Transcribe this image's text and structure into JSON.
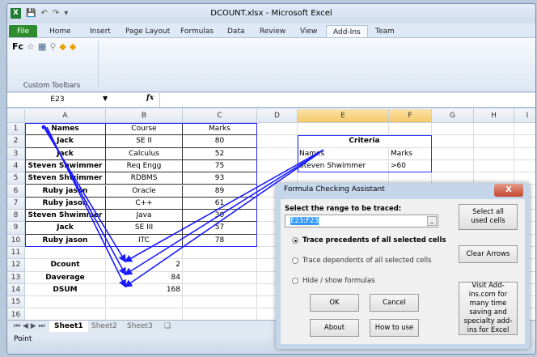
{
  "window": {
    "title": "DCOUNT.xlsx - Microsoft Excel"
  },
  "ribbon": {
    "tabs": [
      "File",
      "Home",
      "Insert",
      "Page Layout",
      "Formulas",
      "Data",
      "Review",
      "View",
      "Add-Ins",
      "Team"
    ],
    "active_tab": "Add-Ins",
    "group_label": "Custom Toolbars",
    "fc_label": "Fc"
  },
  "formula_bar": {
    "name_box": "E23",
    "fx": "fx",
    "value": ""
  },
  "columns": [
    "A",
    "B",
    "C",
    "D",
    "E",
    "F",
    "G",
    "H",
    "I"
  ],
  "selected_columns": [
    "E",
    "F"
  ],
  "rows": [
    "1",
    "2",
    "3",
    "4",
    "5",
    "6",
    "7",
    "8",
    "9",
    "10",
    "11",
    "12",
    "13",
    "14",
    "15",
    "16"
  ],
  "cells": {
    "A1": "Names",
    "B1": "Course",
    "C1": "Marks",
    "A2": "Jack",
    "B2": "SE II",
    "C2": "80",
    "A3": "Jack",
    "B3": "Calculus",
    "C3": "52",
    "A4": "Steven Shwimmer",
    "B4": "Req Engg",
    "C4": "75",
    "A5": "Steven Shwimmer",
    "B5": "RDBMS",
    "C5": "93",
    "A6": "Ruby jason",
    "B6": "Oracle",
    "C6": "89",
    "A7": "Ruby jason",
    "B7": "C++",
    "C7": "61",
    "A8": "Steven Shwimmer",
    "B8": "Java",
    "C8": "30",
    "A9": "Jack",
    "B9": "SE III",
    "C9": "57",
    "A10": "Ruby jason",
    "B10": "ITC",
    "C10": "78",
    "A12": "Dcount",
    "B12": "2",
    "A13": "Daverage",
    "B13": "84",
    "A14": "DSUM",
    "B14": "168",
    "E2": "Criteria",
    "E3": "Names",
    "F3": "Marks",
    "E4": "Steven Shwimmer",
    "F4": ">60"
  },
  "sheets": [
    "Sheet1",
    "Sheet2",
    "Sheet3"
  ],
  "active_sheet": "Sheet1",
  "status": "Point",
  "dialog": {
    "title": "Formula Checking Assistant",
    "close": "X",
    "range_label": "Select the range to be traced:",
    "range_value": "E23:F23",
    "options": [
      {
        "label": "Trace precedents of all selected cells",
        "selected": true
      },
      {
        "label": "Trace dependents of all selected cells",
        "selected": false
      },
      {
        "label": "Hide / show formulas",
        "selected": false
      }
    ],
    "buttons": {
      "ok": "OK",
      "cancel": "Cancel",
      "about": "About",
      "how_to_use": "How to use",
      "select_all": "Select all used cells",
      "clear_arrows": "Clear Arrows",
      "visit": "Visit Add-ins.com for many time saving and specialty add-ins for Excel"
    }
  },
  "colors": {
    "arrow": "#1a1aff",
    "file_tab": "#2e8b2e",
    "selected_header": "#f5c86a"
  }
}
